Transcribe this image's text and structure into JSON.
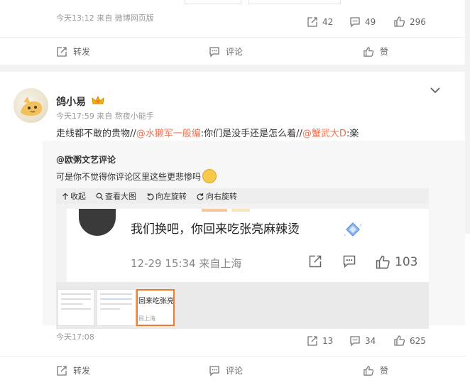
{
  "post1": {
    "meta": "今天13:12 来自 微博网页版",
    "repost_count": "42",
    "comment_count": "49",
    "like_count": "296",
    "actions": {
      "repost": "转发",
      "comment": "评论",
      "like": "赞"
    }
  },
  "post2": {
    "username": "鸽小易",
    "meta": "今天17:59  来自 熬夜小能手",
    "text_before": "走线都不敢的贵物//",
    "mention1": "@水獭军一般编",
    "text_mid": ":你们是没手还是怎么着//",
    "mention2": "@蟹武大D",
    "text_after": ":楽",
    "repost": {
      "author": "@欧粥文艺评论",
      "text": "可是你不觉得你评论区里这些更悲惨吗"
    },
    "toolbar": {
      "collapse": "收起",
      "view_large": "查看大图",
      "rotate_left": "向左旋转",
      "rotate_right": "向右旋转"
    },
    "image": {
      "comment": "我们换吧，你回来吃张亮麻辣烫",
      "time": "12-29 15:34  来自上海",
      "like_count": "103"
    },
    "thumb_selected": {
      "title": "回来吃张亮l",
      "loc": "目上海"
    },
    "time": "今天17:08",
    "repost_count": "13",
    "comment_count": "34",
    "like_count": "625",
    "actions": {
      "repost": "转发",
      "comment": "评论",
      "like": "赞"
    }
  },
  "colors": {
    "accent": "#eb7350",
    "selected": "#f47a2b"
  }
}
